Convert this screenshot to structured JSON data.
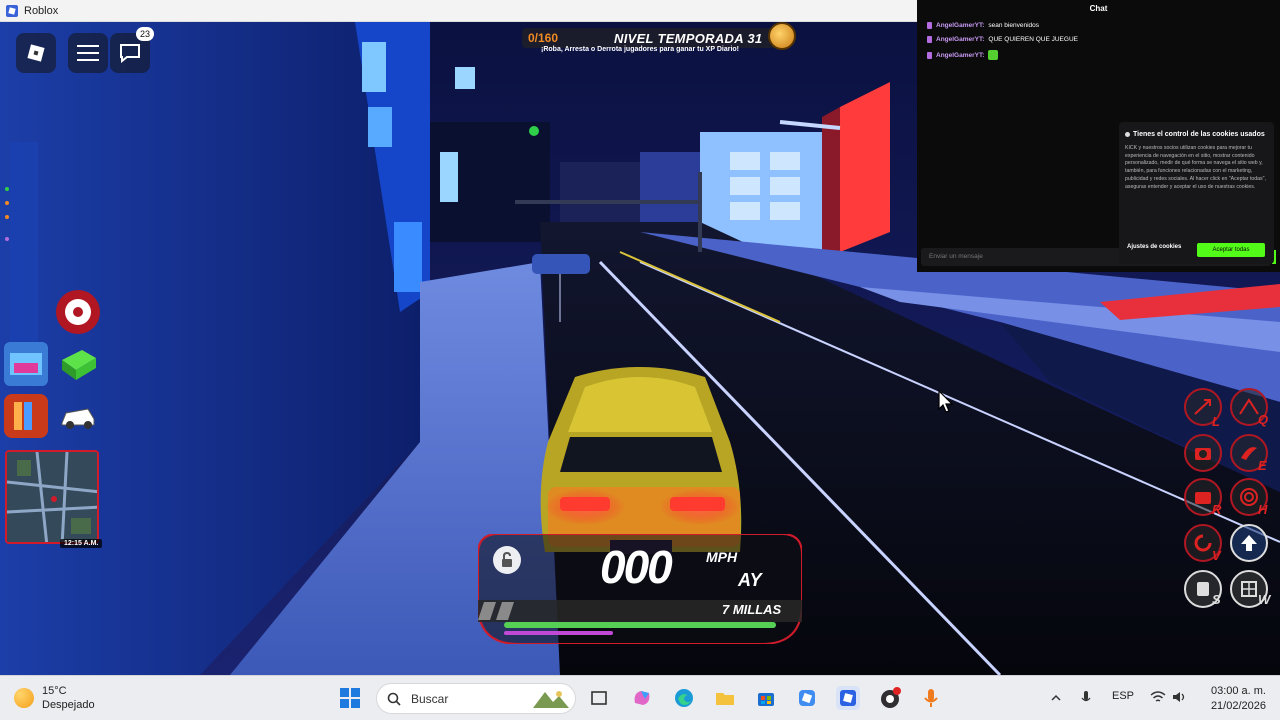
{
  "window": {
    "title": "Roblox"
  },
  "roblox_menu": {
    "chat_badge": "23"
  },
  "hud": {
    "xp": "0/160",
    "level_text": "NIVEL TEMPORADA 31",
    "xp_hint": "¡Roba, Arresta o Derrota jugadores para ganar tu XP Diario!",
    "clock": "12:15 A.M."
  },
  "speedometer": {
    "speed": "000",
    "unit": "MPH",
    "plate": "AY",
    "distance": "7 MILLAS",
    "fuel_fraction": 1.0,
    "nitro_fraction": 0.4
  },
  "right_controls": {
    "keys": [
      "L",
      "Q",
      "E",
      "R",
      "V",
      "S",
      "W"
    ]
  },
  "chat": {
    "title": "Chat",
    "messages": [
      {
        "user": "AngelGamerYT:",
        "text": "sean bienvenidos"
      },
      {
        "user": "AngelGamerYT:",
        "text": "QUE QUIEREN QUE JUEGUE"
      },
      {
        "user": "AngelGamerYT:",
        "text": ""
      }
    ],
    "input_placeholder": "Enviar un mensaje",
    "cookie": {
      "title": "Tienes el control de las cookies usados",
      "text": "KICK y nuestros socios utilizan cookies para mejorar tu experiencia de navegación en el sitio, mostrar contenido personalizado, medir de qué forma se navega el sitio web y, también, para funciones relacionadas con el marketing, publicidad y redes sociales. Al hacer click en \"Aceptar todas\", aseguras entender y aceptar el uso de nuestras cookies.",
      "settings_label": "Ajustes de cookies",
      "accept_label": "Aceptar todas"
    }
  },
  "taskbar": {
    "temperature": "15°C",
    "condition": "Despejado",
    "search_label": "Buscar",
    "language": "ESP",
    "time": "03:00 a. m.",
    "date": "21/02/2026"
  },
  "colors": {
    "kick_green": "#53fc18",
    "hud_red": "#d11b2b",
    "chat_user": "#c89af2"
  }
}
